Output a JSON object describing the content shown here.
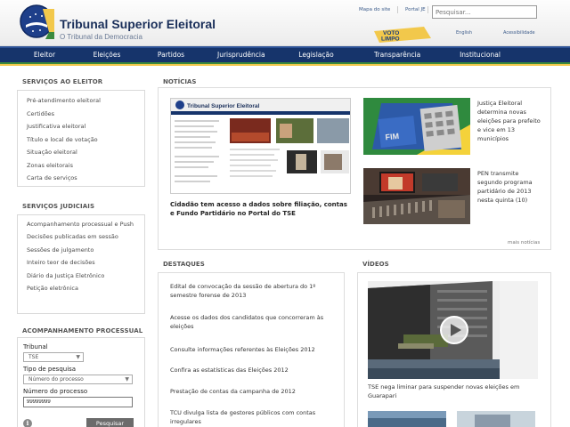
{
  "header": {
    "title": "Tribunal Superior Eleitoral",
    "subtitle": "O Tribunal da Democracia",
    "links": {
      "site_map": "Mapa do site",
      "portal": "Portal JE",
      "english": "English",
      "accessibility": "Acessibilidade"
    },
    "search_placeholder": "Pesquisar...",
    "badge": {
      "line1": "VOTO",
      "line2": "LIMPO"
    }
  },
  "nav": [
    "Eleitor",
    "Eleições",
    "Partidos",
    "Jurisprudência",
    "Legislação",
    "Transparência",
    "Institucional"
  ],
  "voter_services": {
    "title": "SERVIÇOS AO ELEITOR",
    "items": [
      "Pré-atendimento eleitoral",
      "Certidões",
      "Justificativa eleitoral",
      "Título e local de votação",
      "Situação eleitoral",
      "Zonas eleitorais",
      "Carta de serviços"
    ]
  },
  "judicial_services": {
    "title": "SERVIÇOS JUDICIAIS",
    "items": [
      "Acompanhamento processual e Push",
      "Decisões publicadas em sessão",
      "Sessões de julgamento",
      "Inteiro teor de decisões",
      "Diário da Justiça Eletrônico",
      "Petição eletrônica"
    ]
  },
  "process_tracking": {
    "title": "ACOMPANHAMENTO PROCESSUAL",
    "court_label": "Tribunal",
    "court_value": "TSE",
    "type_label": "Tipo de pesquisa",
    "type_value": "Número do processo",
    "number_label": "Número do processo",
    "number_value": "99999999",
    "info_symbol": "i",
    "button": "Pesquisar"
  },
  "news": {
    "title": "NOTÍCIAS",
    "main_caption": "Cidadão tem acesso a dados sobre filiação, contas e Fundo Partidário no Portal do TSE",
    "preview_title": "Tribunal Superior Eleitoral",
    "side": [
      {
        "caption": "Justiça Eleitoral determina novas eleições para prefeito e vice em 13 municípios",
        "image_label": "FIM"
      },
      {
        "caption": "PEN transmite segundo programa partidário de 2013 nesta quinta (10)"
      }
    ],
    "more": "mais notícias"
  },
  "highlights": {
    "title": "DESTAQUES",
    "items": [
      "Edital de convocação da sessão de abertura do 1º semestre forense de 2013",
      "Acesse os dados dos candidatos que concorreram às eleições",
      "Consulte informações referentes às Eleições 2012",
      "Confira as estatísticas das Eleições 2012",
      "Prestação de contas da campanha de 2012",
      "TCU divulga lista de gestores públicos com contas irregulares"
    ]
  },
  "videos": {
    "title": "VÍDEOS",
    "main_caption": "TSE nega liminar para suspender novas eleições em Guarapari"
  },
  "colors": {
    "nav_bg": "#16346b",
    "brand_green": "#3b8a3e",
    "brand_yellow": "#f2c84b",
    "title_blue": "#1a2f5a"
  },
  "icons": {
    "logo": "tse-emblem-icon",
    "info": "info-icon",
    "play": "play-icon",
    "dropdown": "chevron-down-icon"
  }
}
